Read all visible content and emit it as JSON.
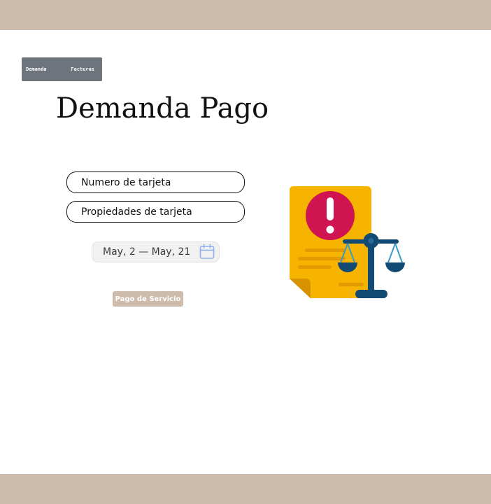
{
  "nav": {
    "items": [
      {
        "label": "Demanda"
      },
      {
        "label": "Facturas"
      }
    ]
  },
  "page": {
    "title": "Demanda Pago"
  },
  "form": {
    "card_number_placeholder": "Numero de tarjeta",
    "card_properties_placeholder": "Propiedades de tarjeta",
    "date_range": "May, 2 — May, 21",
    "submit_label": "Pago de Servicio"
  },
  "icons": {
    "calendar": "calendar-icon",
    "illustration": "lawsuit-document-scale-icon"
  },
  "colors": {
    "band": "#cdbcab",
    "nav_bg": "#6e747b",
    "button_bg": "#cdbcab",
    "document": "#f6b400",
    "alert": "#cf1451",
    "scale": "#124a73"
  }
}
